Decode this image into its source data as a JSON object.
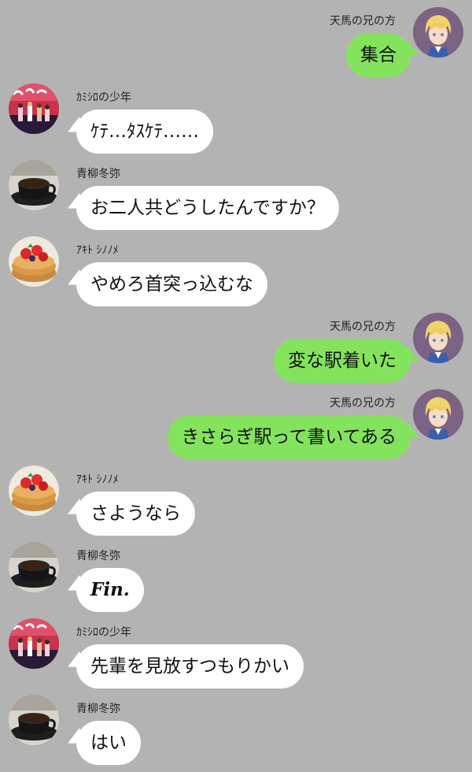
{
  "messages": [
    {
      "side": "right",
      "sender": "天馬の兄の方",
      "avatar": "blonde-boy-avatar",
      "text": "集合"
    },
    {
      "side": "left",
      "sender": "ｶﾐｼﾛの少年",
      "avatar": "stage-group-avatar",
      "text": "ｹﾃ…ﾀｽｹﾃ……"
    },
    {
      "side": "left",
      "sender": "青柳冬弥",
      "avatar": "coffee-cup-avatar",
      "text": "お二人共どうしたんですか？"
    },
    {
      "side": "left",
      "sender": "ｱｷﾄ ｼﾉﾉﾒ",
      "avatar": "pancake-avatar",
      "text": "やめろ首突っ込むな"
    },
    {
      "side": "right",
      "sender": "天馬の兄の方",
      "avatar": "blonde-boy-avatar",
      "text": "変な駅着いた"
    },
    {
      "side": "right",
      "sender": "天馬の兄の方",
      "avatar": "blonde-boy-avatar",
      "text": "きさらぎ駅って書いてある"
    },
    {
      "side": "left",
      "sender": "ｱｷﾄ ｼﾉﾉﾒ",
      "avatar": "pancake-avatar",
      "text": "さようなら"
    },
    {
      "side": "left",
      "sender": "青柳冬弥",
      "avatar": "coffee-cup-avatar",
      "text": "Fin.",
      "italic": true
    },
    {
      "side": "left",
      "sender": "ｶﾐｼﾛの少年",
      "avatar": "stage-group-avatar",
      "text": "先輩を見放すつもりかい"
    },
    {
      "side": "left",
      "sender": "青柳冬弥",
      "avatar": "coffee-cup-avatar",
      "text": "はい"
    }
  ],
  "colors": {
    "background": "#b3b3b3",
    "outgoing_bubble": "#84e35d",
    "incoming_bubble": "#ffffff"
  }
}
